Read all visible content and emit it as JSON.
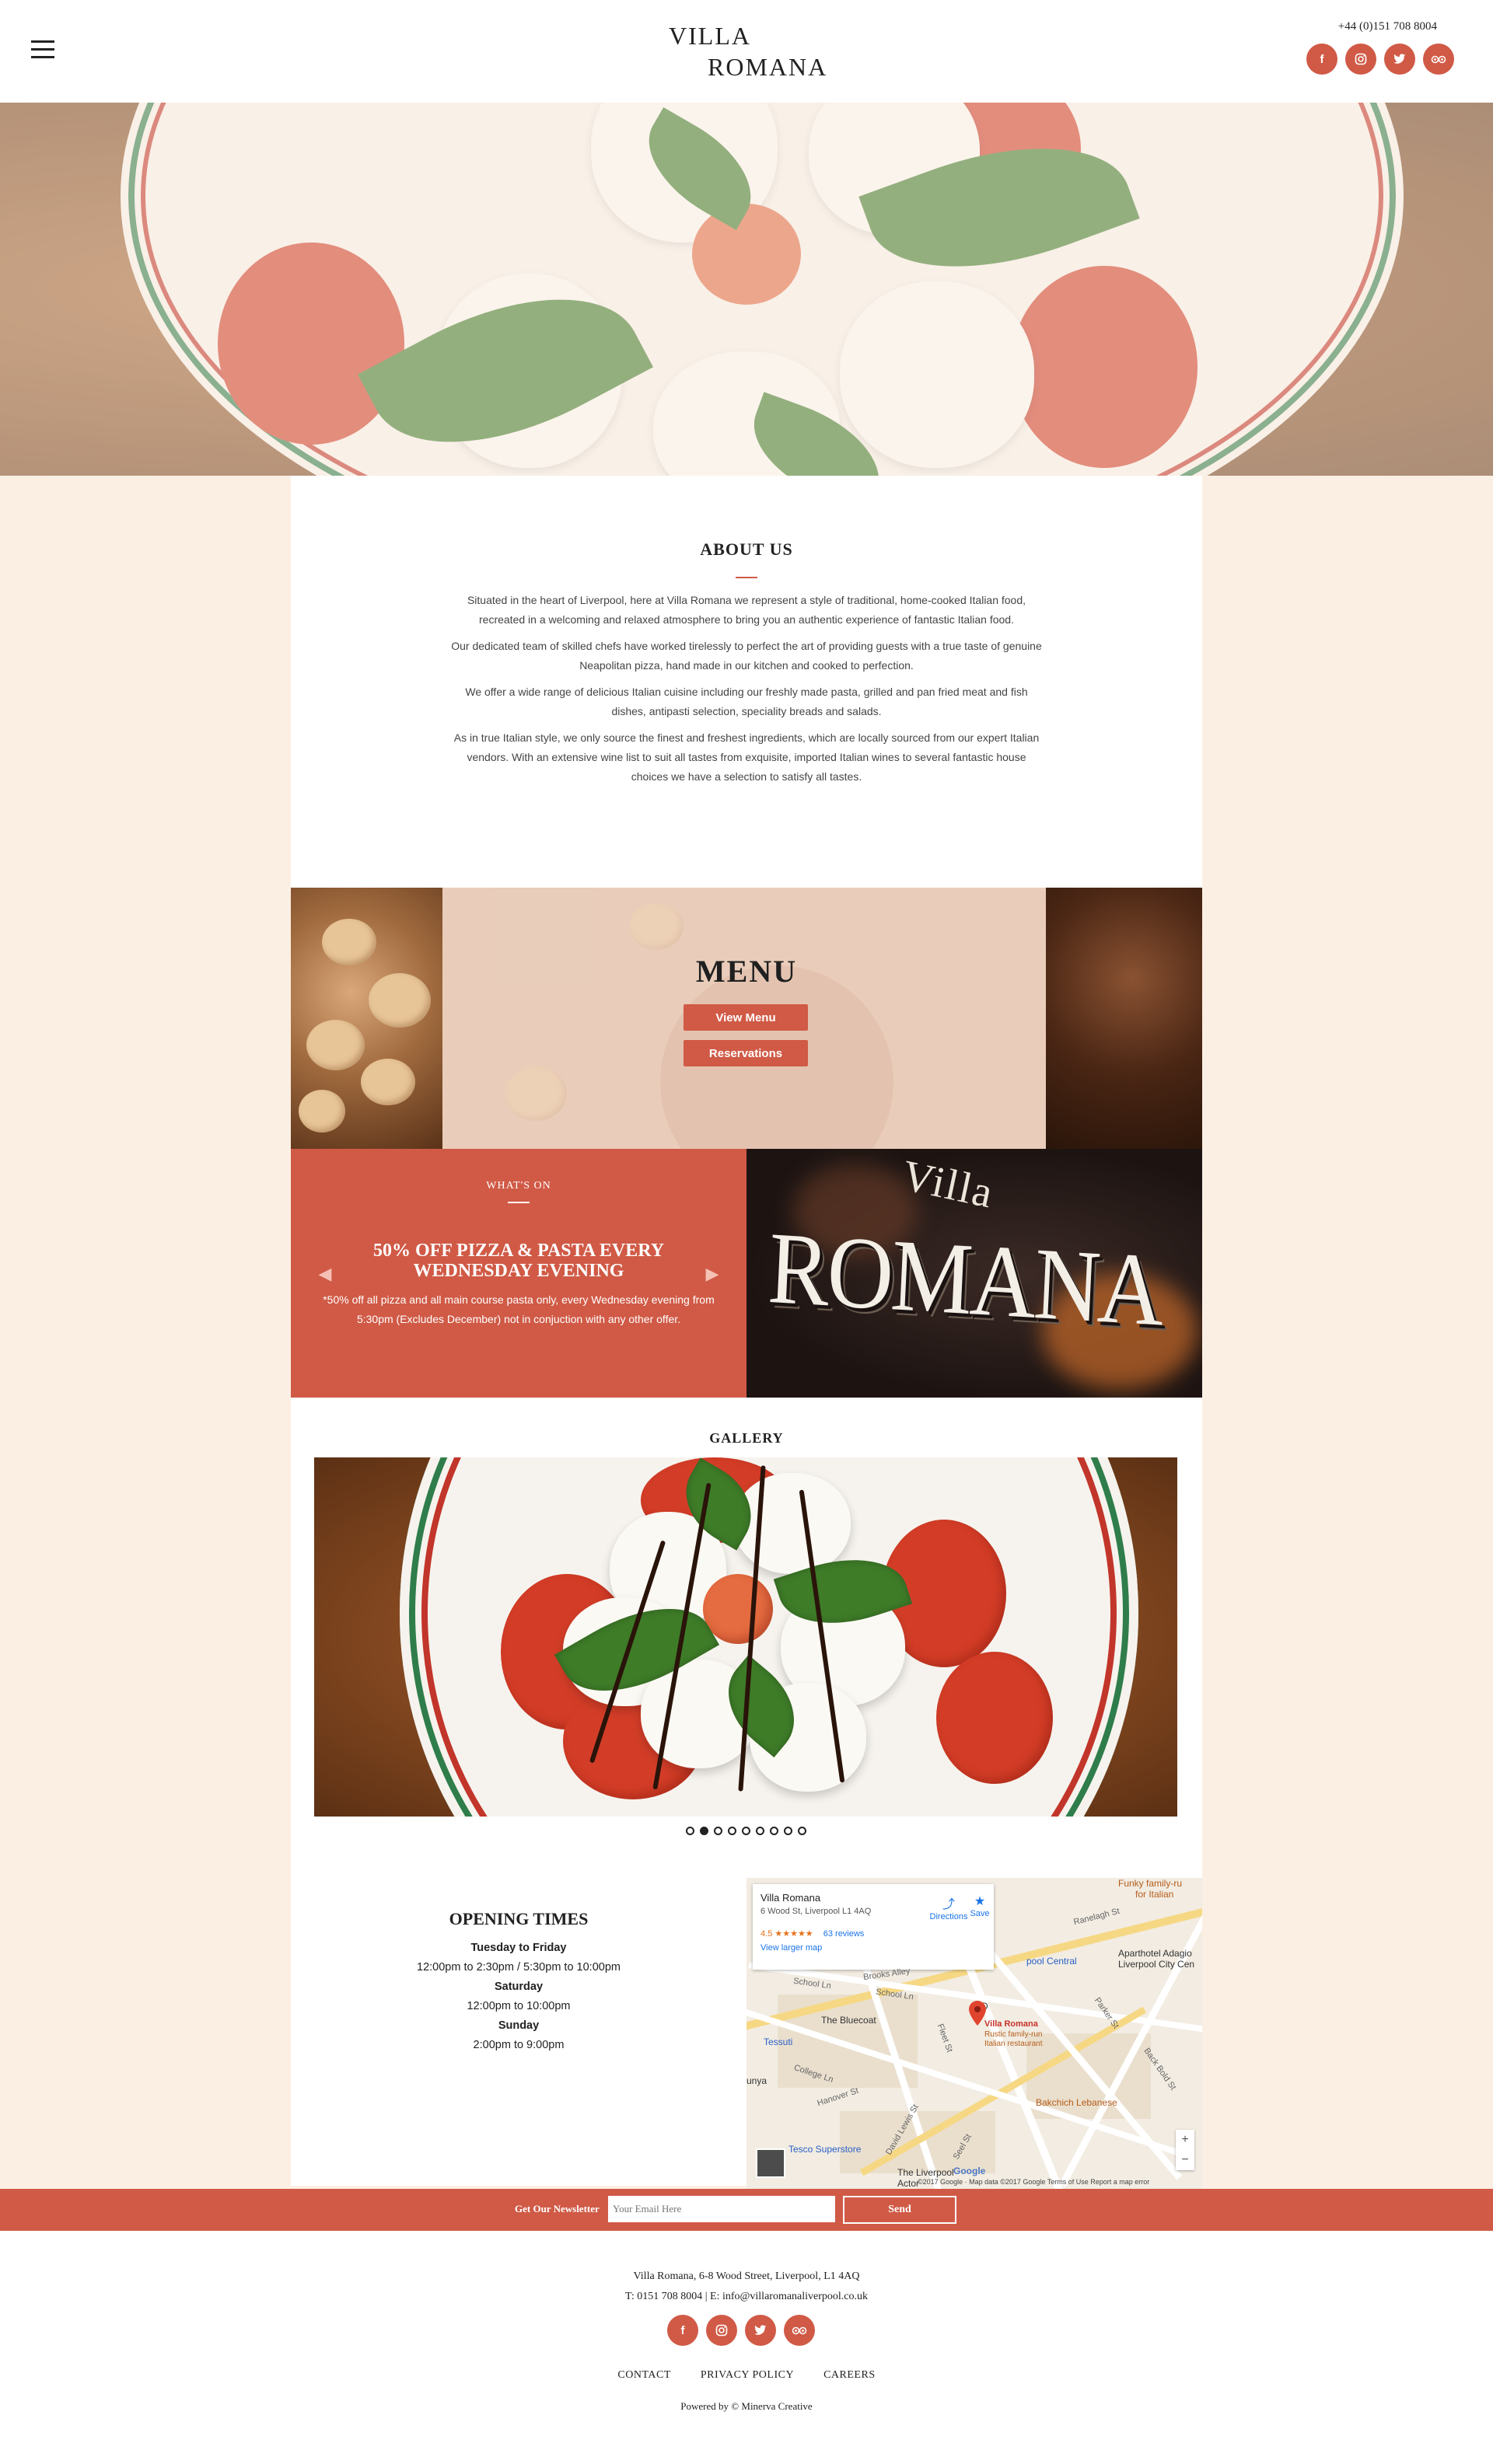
{
  "header": {
    "logo_line1": "VILLA",
    "logo_line2": "ROMANA",
    "phone": "+44 (0)151 708 8004",
    "social_icons": [
      "facebook-icon",
      "instagram-icon",
      "twitter-icon",
      "tripadvisor-icon"
    ]
  },
  "about": {
    "title": "ABOUT US",
    "paragraphs": [
      "Situated in the heart of Liverpool, here at Villa Romana we represent a style of traditional, home-cooked Italian food, recreated in a welcoming and relaxed atmosphere to bring you an authentic experience of fantastic Italian food.",
      "Our dedicated team of skilled chefs have worked tirelessly to perfect the art of providing guests with a true taste of genuine Neapolitan pizza, hand made in our kitchen and cooked to perfection.",
      "We offer a wide range of delicious Italian cuisine including our freshly made pasta, grilled and pan fried meat and fish dishes, antipasti selection, speciality breads and salads.",
      "As in true Italian style, we only source the finest and freshest ingredients, which are locally sourced from our expert Italian vendors. With an extensive wine list to suit all tastes from exquisite, imported Italian wines to several fantastic house choices we have a selection to satisfy all tastes."
    ]
  },
  "menu": {
    "title": "MENU",
    "view_menu_label": "View Menu",
    "reservations_label": "Reservations"
  },
  "whats_on": {
    "label": "WHAT'S ON",
    "title": "50% OFF PIZZA & PASTA EVERY WEDNESDAY EVENING",
    "body": "*50% off all pizza and all main course pasta only, every Wednesday evening from 5:30pm (Excludes December) not in conjuction with any other offer."
  },
  "sign": {
    "line1": "Villa",
    "line2": "ROMANA"
  },
  "gallery": {
    "title": "GALLERY",
    "slide_count": 9,
    "active_slide": 2
  },
  "opening": {
    "title": "OPENING TIMES",
    "rows": [
      {
        "day": "Tuesday to Friday",
        "hours": "12:00pm to 2:30pm / 5:30pm to 10:00pm"
      },
      {
        "day": "Saturday",
        "hours": "12:00pm to 10:00pm"
      },
      {
        "day": "Sunday",
        "hours": "2:00pm to 9:00pm"
      }
    ]
  },
  "map": {
    "card_name": "Villa Romana",
    "card_address": "6 Wood St, Liverpool L1 4AQ",
    "rating": "4.5",
    "stars": "★★★★★",
    "reviews": "63 reviews",
    "larger_map": "View larger map",
    "directions": "Directions",
    "save": "Save",
    "pin_name": "Villa Romana",
    "pin_desc1": "Rustic family-run",
    "pin_desc2": "Italian restaurant",
    "labels": {
      "funky": "Funky family-ru",
      "funky2": "for Italian",
      "aparthotel": "Aparthotel Adagio",
      "aparthotel2": "Liverpool City Cen",
      "central": "pool Central",
      "bluecoat": "The Bluecoat",
      "tessuti": "Tessuti",
      "bakchich": "Bakchich Lebanese",
      "tesco": "Tesco Superstore",
      "unya": "unya",
      "doubletree": "D",
      "liverpool_one": "The Liverpool",
      "actor": "Actor"
    },
    "streets": {
      "school": "School Ln",
      "school2": "School Ln",
      "ranelagh": "Ranelagh St",
      "college": "College Ln",
      "hanover": "Hanover St",
      "seel": "Seel St",
      "fleet": "Fleet St",
      "back_bold": "Back Bold St",
      "parker": "Parker St",
      "brooks": "Brooks Alley",
      "david_lewis": "David Lewis St"
    },
    "footer": "©2017 Google · Map data ©2017 Google   Terms of Use   Report a map error",
    "google": "Google"
  },
  "newsletter": {
    "label": "Get Our Newsletter",
    "placeholder": "Your Email Here",
    "send_label": "Send"
  },
  "footer": {
    "address": "Villa Romana, 6-8 Wood Street, Liverpool, L1 4AQ",
    "contact": "T: 0151 708 8004 | E: info@villaromanaliverpool.co.uk",
    "links": [
      "CONTACT",
      "PRIVACY POLICY",
      "CAREERS"
    ],
    "powered": "Powered by © Minerva Creative"
  },
  "colors": {
    "accent": "#d05a46",
    "background": "#fbefe4"
  }
}
